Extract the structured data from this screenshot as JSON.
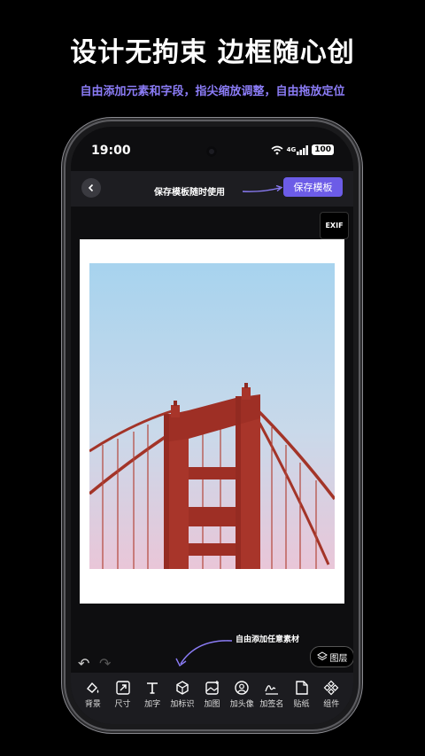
{
  "banner": {
    "headline": "设计无拘束 边框随心创",
    "subline": "自由添加元素和字段，指尖缩放调整，自由拖放定位"
  },
  "status_bar": {
    "time": "19:00",
    "network": "4G",
    "battery": "100"
  },
  "editor": {
    "save_annotation": "保存模板随时使用",
    "save_button": "保存模板",
    "exif_button": "EXIF",
    "add_annotation": "自由添加任意素材",
    "layers_button": "图层"
  },
  "toolbar": {
    "items": [
      {
        "label": "背景",
        "icon": "background-icon"
      },
      {
        "label": "尺寸",
        "icon": "resize-icon"
      },
      {
        "label": "加字",
        "icon": "text-icon"
      },
      {
        "label": "加标识",
        "icon": "logo-icon"
      },
      {
        "label": "加图",
        "icon": "image-icon"
      },
      {
        "label": "加头像",
        "icon": "avatar-icon"
      },
      {
        "label": "加签名",
        "icon": "signature-icon"
      },
      {
        "label": "贴纸",
        "icon": "sticker-icon"
      },
      {
        "label": "组件",
        "icon": "component-icon"
      }
    ]
  },
  "colors": {
    "accent": "#6c5ce7",
    "subline": "#8b7cf6",
    "background": "#000000"
  }
}
